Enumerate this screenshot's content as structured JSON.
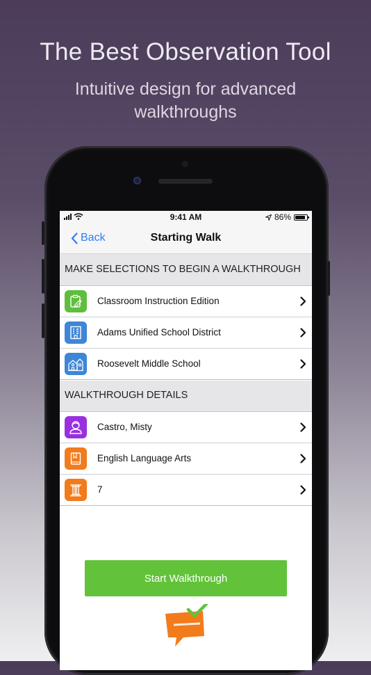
{
  "promo": {
    "headline": "The Best Observation Tool",
    "subhead": "Intuitive design for advanced walkthroughs"
  },
  "status_bar": {
    "time": "9:41 AM",
    "battery": "86%",
    "battery_level": 0.86
  },
  "nav": {
    "back_label": "Back",
    "title": "Starting Walk"
  },
  "sections": [
    {
      "header": "MAKE SELECTIONS TO BEGIN A WALKTHROUGH",
      "rows": [
        {
          "label": "Classroom Instruction Edition",
          "icon": "clipboard-icon",
          "color": "#5fbf3c"
        },
        {
          "label": "Adams Unified School District",
          "icon": "building-icon",
          "color": "#3d86d8"
        },
        {
          "label": "Roosevelt Middle School",
          "icon": "school-icon",
          "color": "#3d86d8"
        }
      ]
    },
    {
      "header": "WALKTHROUGH DETAILS",
      "rows": [
        {
          "label": "Castro, Misty",
          "icon": "person-icon",
          "color": "#9a2fe0"
        },
        {
          "label": "English Language Arts",
          "icon": "book-icon",
          "color": "#f27b1b"
        },
        {
          "label": "7",
          "icon": "column-icon",
          "color": "#f27b1b"
        }
      ]
    }
  ],
  "actions": {
    "start_label": "Start Walkthrough",
    "start_color": "#62c33a"
  },
  "colors": {
    "accent": "#2f7cf6",
    "logo_orange": "#f27b1b",
    "logo_check": "#62c33a"
  }
}
